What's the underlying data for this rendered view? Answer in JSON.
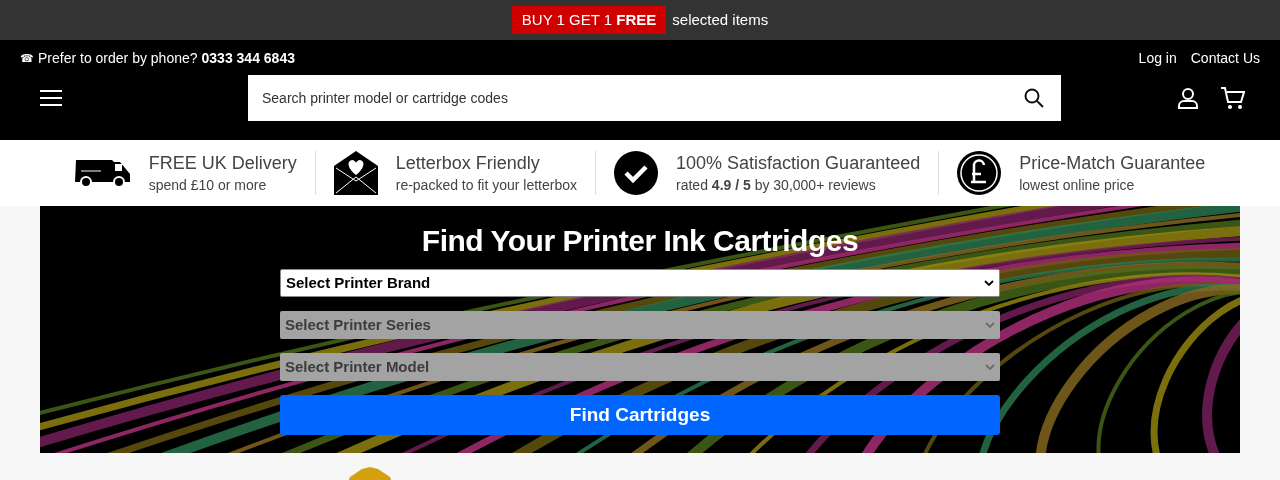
{
  "promo_bar": {
    "badge": "BUY 1 GET 1 **FREE**",
    "text": "selected items"
  },
  "top_bar": {
    "phone_icon": "☎",
    "phone_label": "Prefer to order by phone?",
    "phone_number": "0333 344 6843",
    "links": [
      "Log in",
      "Contact Us"
    ]
  },
  "search": {
    "placeholder": "Search printer model or cartridge codes"
  },
  "benefits": [
    {
      "kind": "van",
      "title": "FREE UK Delivery",
      "subtitle": "spend £10 or more"
    },
    {
      "kind": "envelope",
      "title": "Letterbox Friendly",
      "subtitle": "re-packed to fit your letterbox"
    },
    {
      "kind": "check",
      "title": "100% Satisfaction Guaranteed",
      "subtitle": "rated **4.9 / 5** by 30,000+ reviews"
    },
    {
      "kind": "pound",
      "title": "Price-Match Guarantee",
      "subtitle": "lowest online price"
    }
  ],
  "finder": {
    "title": "Find Your Printer Ink Cartridges",
    "selects": [
      {
        "label": "Select Printer Brand",
        "disabled": false
      },
      {
        "label": "Select Printer Series",
        "disabled": true
      },
      {
        "label": "Select Printer Model",
        "disabled": true
      }
    ],
    "button": "Find Cartridges"
  }
}
